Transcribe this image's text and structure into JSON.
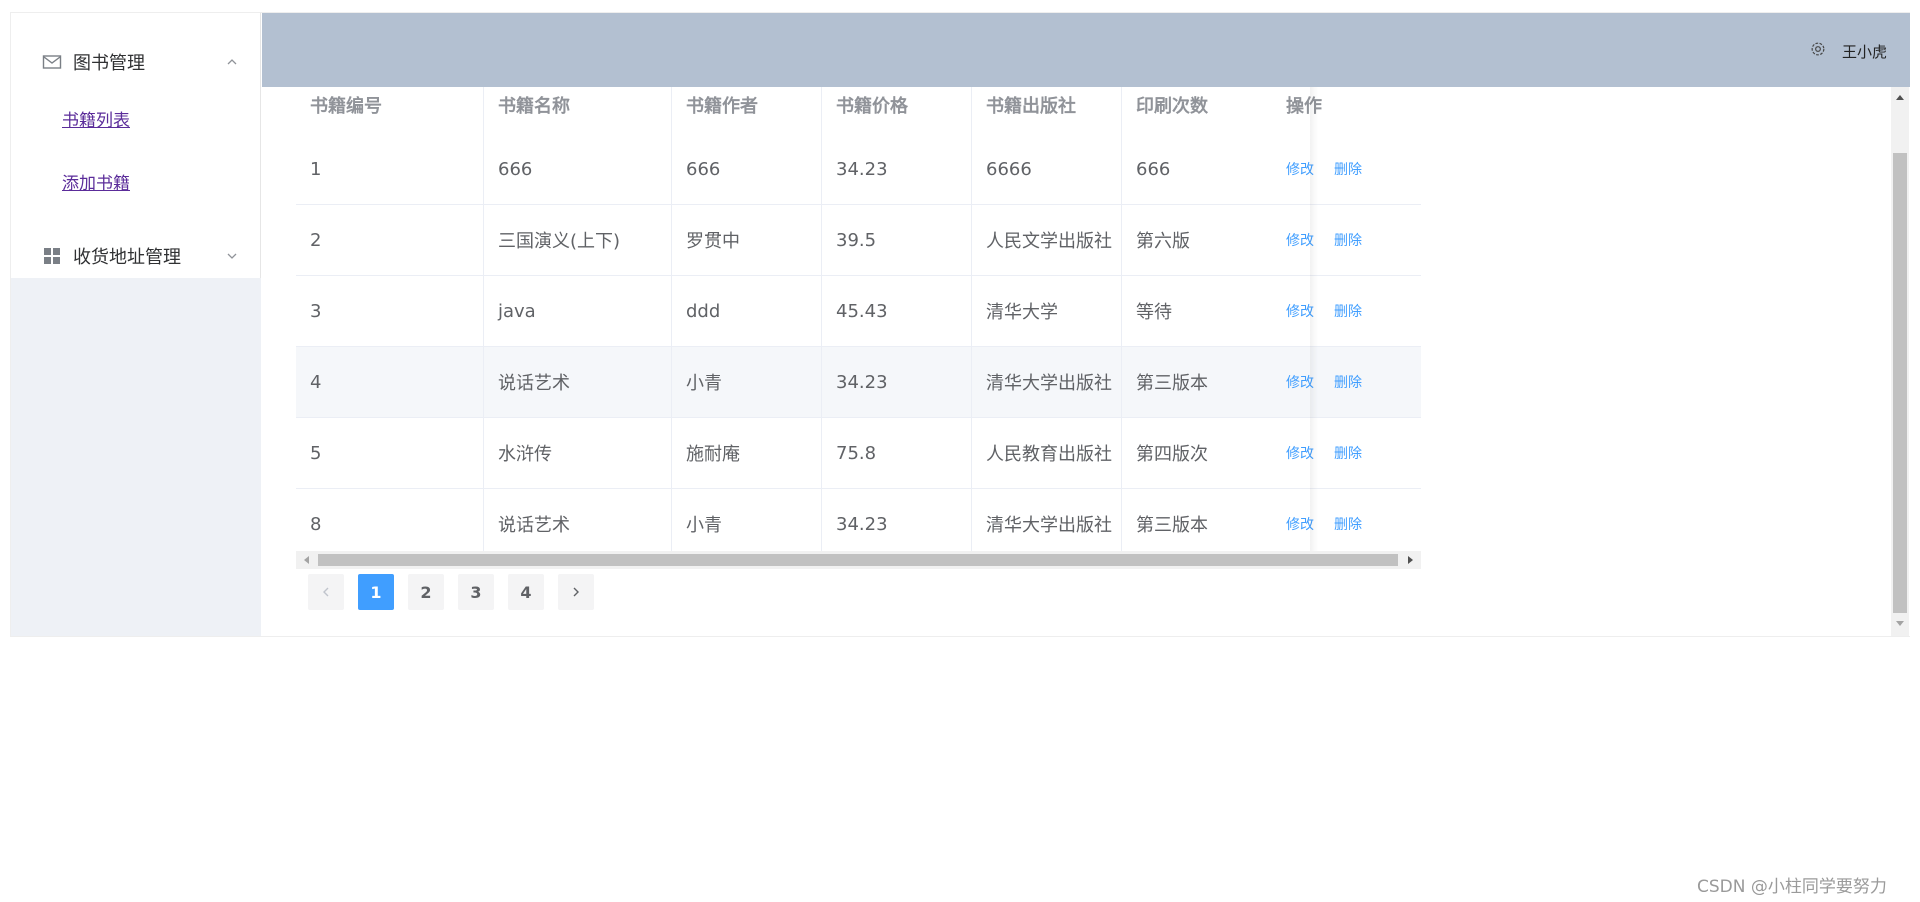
{
  "sidebar": {
    "group1": {
      "title": "图书管理",
      "icon": "mail-icon",
      "arrow": "chevron-up-icon"
    },
    "items": [
      {
        "label": "书籍列表"
      },
      {
        "label": "添加书籍"
      }
    ],
    "group2": {
      "title": "收货地址管理",
      "icon": "grid-icon",
      "arrow": "chevron-down-icon"
    }
  },
  "header": {
    "settings_icon": "gear-icon",
    "user": "王小虎",
    "bg": "#b3c0d1"
  },
  "table": {
    "columns": [
      "书籍编号",
      "书籍名称",
      "书籍作者",
      "书籍价格",
      "书籍出版社",
      "印刷次数",
      "操作"
    ],
    "rows": [
      [
        "1",
        "666",
        "666",
        "34.23",
        "6666",
        "666"
      ],
      [
        "2",
        "三国演义(上下)",
        "罗贯中",
        "39.5",
        "人民文学出版社",
        "第六版"
      ],
      [
        "3",
        "java",
        "ddd",
        "45.43",
        "清华大学",
        "等待"
      ],
      [
        "4",
        "说话艺术",
        "小青",
        "34.23",
        "清华大学出版社",
        "第三版本"
      ],
      [
        "5",
        "水浒传",
        "施耐庵",
        "75.8",
        "人民教育出版社",
        "第四版次"
      ],
      [
        "8",
        "说话艺术",
        "小青",
        "34.23",
        "清华大学出版社",
        "第三版本"
      ]
    ],
    "actions": {
      "edit": "修改",
      "delete": "删除"
    },
    "link_color": "#409eff"
  },
  "pagination": {
    "prev_icon": "chevron-left-icon",
    "pages": [
      "1",
      "2",
      "3",
      "4"
    ],
    "current": "1",
    "next_icon": "chevron-right-icon",
    "active_color": "#409eff"
  },
  "watermark": "CSDN @小柱同学要努力"
}
